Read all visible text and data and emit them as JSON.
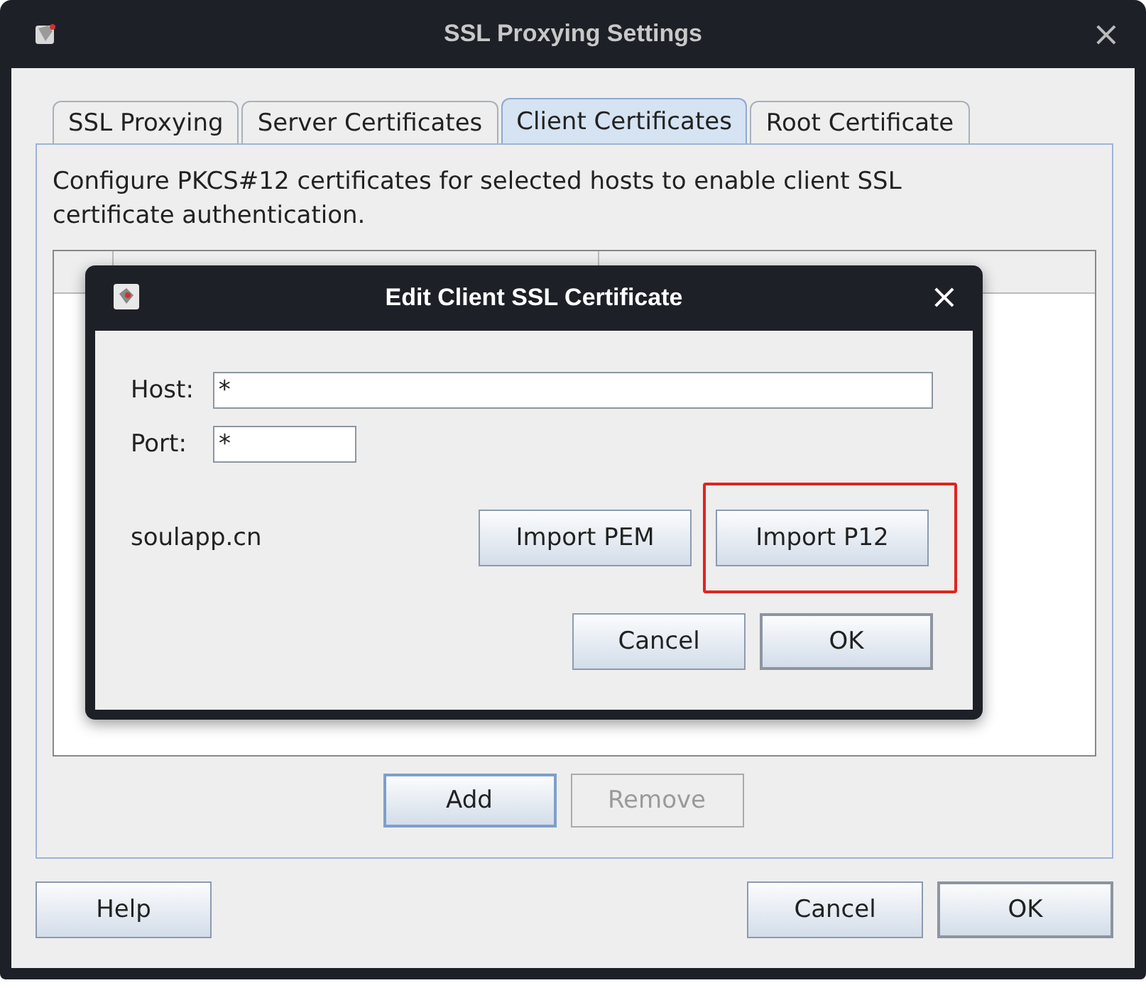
{
  "window": {
    "title": "SSL Proxying Settings",
    "close": "×"
  },
  "tabs": [
    {
      "label": "SSL Proxying",
      "selected": false
    },
    {
      "label": "Server Certificates",
      "selected": false
    },
    {
      "label": "Client Certificates",
      "selected": true
    },
    {
      "label": "Root Certificate",
      "selected": false
    }
  ],
  "description": "Configure PKCS#12 certificates for selected hosts to enable client SSL certificate authentication.",
  "table_buttons": [
    {
      "label": "Add",
      "disabled": false,
      "default": true
    },
    {
      "label": "Remove",
      "disabled": true,
      "default": false
    }
  ],
  "footer": {
    "help": "Help",
    "buttons": [
      {
        "label": "Cancel",
        "default": false
      },
      {
        "label": "OK",
        "default": true
      }
    ]
  },
  "dialog": {
    "title": "Edit Client SSL Certificate",
    "close": "×",
    "fields": [
      {
        "label": "Host:",
        "value": "*",
        "kind": "wide"
      },
      {
        "label": "Port:",
        "value": "*",
        "kind": "narrow"
      }
    ],
    "domain": "soulapp.cn",
    "import_buttons": [
      {
        "label": "Import PEM",
        "highlighted": false
      },
      {
        "label": "Import P12",
        "highlighted": true
      }
    ],
    "buttons": [
      {
        "label": "Cancel",
        "default": false
      },
      {
        "label": "OK",
        "default": true
      }
    ]
  }
}
